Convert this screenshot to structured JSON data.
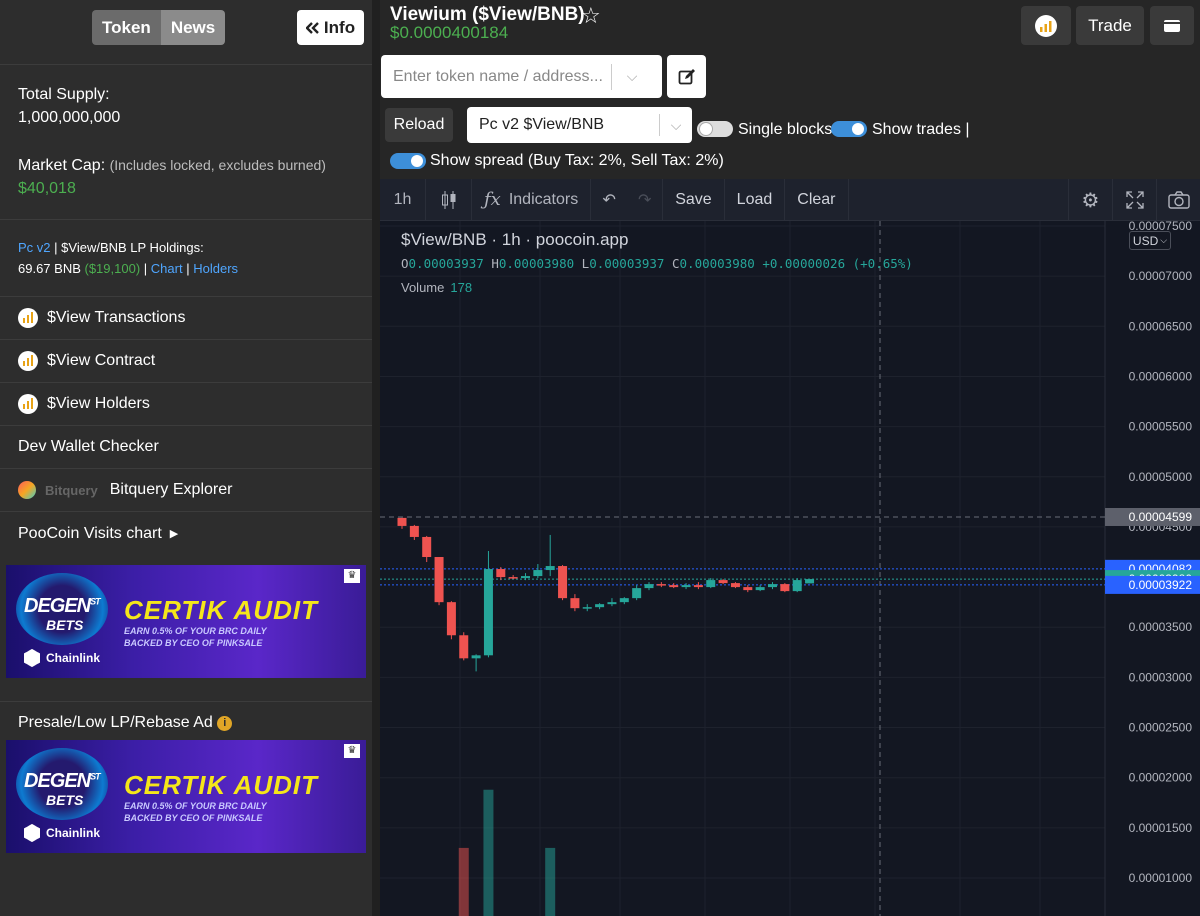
{
  "sidebar": {
    "tabs": [
      {
        "label": "Token",
        "active": true
      },
      {
        "label": "News",
        "active": false
      }
    ],
    "info_button": "Info",
    "total_supply_label": "Total Supply:",
    "total_supply_value": "1,000,000,000",
    "market_cap_label": "Market Cap:",
    "market_cap_note": "(Includes locked, excludes burned)",
    "market_cap_value": "$40,018",
    "lp": {
      "router": "Pc v2",
      "sep1": "|",
      "label": "$View/BNB LP Holdings:",
      "bnb": "69.67 BNB",
      "usd": "($19,100)",
      "sep2": "|",
      "chart_link": "Chart",
      "sep3": "|",
      "holders_link": "Holders"
    },
    "links": [
      {
        "label": "$View Transactions",
        "icon": "bscscan-icon"
      },
      {
        "label": "$View Contract",
        "icon": "bscscan-icon"
      },
      {
        "label": "$View Holders",
        "icon": "bscscan-icon"
      },
      {
        "label": "Dev Wallet Checker",
        "icon": null
      },
      {
        "label": "Bitquery Explorer",
        "icon": "bitquery-logo"
      }
    ],
    "bitquery_brand": "Bitquery",
    "visits_chart": "PooCoin Visits chart",
    "ad_section_title": "Presale/Low LP/Rebase Ad",
    "ad": {
      "degen": "DEGEN",
      "st": "ST",
      "bets": "BETS",
      "headline": "CERTIK AUDIT",
      "line1": "EARN 0.5% OF YOUR BRC DAILY",
      "line2": "BACKED BY CEO OF PINKSALE",
      "chainlink": "Chainlink"
    }
  },
  "header": {
    "title": "Viewium ($View/BNB)",
    "price": "$0.0000400184",
    "trade_button": "Trade",
    "search_placeholder": "Enter token name / address...",
    "reload_button": "Reload",
    "pair_select": "Pc v2 $View/BNB",
    "toggles": [
      {
        "label": "Single blocks",
        "on": false
      },
      {
        "label": "Show trades |",
        "on": true
      },
      {
        "label": "Show spread (Buy Tax: 2%, Sell Tax: 2%)",
        "on": true
      }
    ]
  },
  "chart": {
    "toolbar": {
      "interval": "1h",
      "indicators": "Indicators",
      "save": "Save",
      "load": "Load",
      "clear": "Clear"
    },
    "legend": "$View/BNB · 1h · poocoin.app",
    "ohlc": {
      "o": "0.00003937",
      "h": "0.00003980",
      "l": "0.00003937",
      "c": "0.00003980",
      "change": "+0.00000026 (+0.65%)"
    },
    "volume_label": "Volume",
    "volume_value": "178",
    "currency": "USD",
    "colors": {
      "up": "#26a69a",
      "down": "#ef5350",
      "background": "#131722",
      "accent": "#4caf50",
      "link": "#4fa6ff"
    }
  },
  "chart_data": {
    "type": "candlestick",
    "y_ticks": [
      "0.00007500",
      "0.00007000",
      "0.00006500",
      "0.00006000",
      "0.00005500",
      "0.00005000",
      "0.00004500",
      "0.00003500",
      "0.00003000",
      "0.00002500",
      "0.00002000",
      "0.00001500",
      "0.00001000"
    ],
    "price_markers": [
      {
        "value": "0.00004599",
        "color": "#5d606b"
      },
      {
        "value": "0.00004082",
        "color": "#2962ff"
      },
      {
        "value": "0.00003980",
        "color": "#26a69a"
      },
      {
        "value": "0.00003922",
        "color": "#2962ff"
      }
    ],
    "candles": [
      [
        4.59e-05,
        4.59e-05,
        4.48e-05,
        4.51e-05
      ],
      [
        4.51e-05,
        4.52e-05,
        4.37e-05,
        4.4e-05
      ],
      [
        4.4e-05,
        4.41e-05,
        4.15e-05,
        4.2e-05
      ],
      [
        4.2e-05,
        4.2e-05,
        3.72e-05,
        3.75e-05
      ],
      [
        3.75e-05,
        3.76e-05,
        3.38e-05,
        3.42e-05
      ],
      [
        3.42e-05,
        3.45e-05,
        3.17e-05,
        3.19e-05
      ],
      [
        3.19e-05,
        3.23e-05,
        3.06e-05,
        3.22e-05
      ],
      [
        3.22e-05,
        4.26e-05,
        3.2e-05,
        4.08e-05
      ],
      [
        4.08e-05,
        4.1e-05,
        3.97e-05,
        4e-05
      ],
      [
        4e-05,
        4.02e-05,
        3.98e-05,
        3.99e-05
      ],
      [
        3.99e-05,
        4.04e-05,
        3.97e-05,
        4.01e-05
      ],
      [
        4.01e-05,
        4.13e-05,
        3.99e-05,
        4.07e-05
      ],
      [
        4.07e-05,
        4.42e-05,
        4.01e-05,
        4.11e-05
      ],
      [
        4.11e-05,
        4.12e-05,
        3.77e-05,
        3.79e-05
      ],
      [
        3.79e-05,
        3.83e-05,
        3.66e-05,
        3.69e-05
      ],
      [
        3.69e-05,
        3.73e-05,
        3.66e-05,
        3.7e-05
      ],
      [
        3.7e-05,
        3.74e-05,
        3.68e-05,
        3.73e-05
      ],
      [
        3.73e-05,
        3.79e-05,
        3.71e-05,
        3.75e-05
      ],
      [
        3.75e-05,
        3.8e-05,
        3.73e-05,
        3.79e-05
      ],
      [
        3.79e-05,
        3.92e-05,
        3.77e-05,
        3.89e-05
      ],
      [
        3.89e-05,
        3.95e-05,
        3.87e-05,
        3.93e-05
      ],
      [
        3.93e-05,
        3.95e-05,
        3.9e-05,
        3.92e-05
      ],
      [
        3.92e-05,
        3.94e-05,
        3.89e-05,
        3.9e-05
      ],
      [
        3.9e-05,
        3.94e-05,
        3.88e-05,
        3.92e-05
      ],
      [
        3.92e-05,
        3.95e-05,
        3.88e-05,
        3.9e-05
      ],
      [
        3.9e-05,
        3.99e-05,
        3.89e-05,
        3.97e-05
      ],
      [
        3.97e-05,
        3.98e-05,
        3.93e-05,
        3.94e-05
      ],
      [
        3.94e-05,
        3.95e-05,
        3.89e-05,
        3.9e-05
      ],
      [
        3.9e-05,
        3.92e-05,
        3.85e-05,
        3.87e-05
      ],
      [
        3.87e-05,
        3.92e-05,
        3.86e-05,
        3.9e-05
      ],
      [
        3.9e-05,
        3.95e-05,
        3.88e-05,
        3.93e-05
      ],
      [
        3.93e-05,
        3.94e-05,
        3.85e-05,
        3.86e-05
      ],
      [
        3.86e-05,
        3.99e-05,
        3.85e-05,
        3.97e-05
      ],
      [
        3.937e-05,
        3.98e-05,
        3.937e-05,
        3.98e-05
      ]
    ],
    "volumes": [
      null,
      null,
      null,
      null,
      null,
      1.3e-05,
      null,
      1.88e-05,
      null,
      null,
      null,
      null,
      1.3e-05
    ]
  }
}
